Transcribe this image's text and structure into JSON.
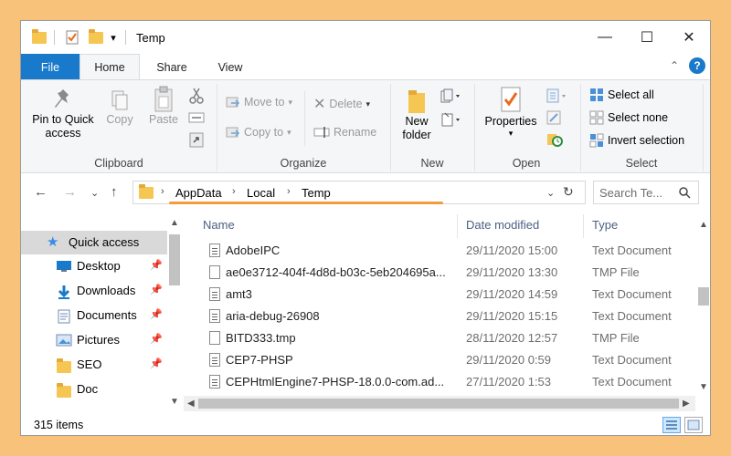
{
  "window": {
    "title": "Temp"
  },
  "controls": {
    "minimize": "—",
    "maximize": "☐",
    "close": "✕",
    "dropdown": "▾",
    "collapse": "⌃",
    "help": "?"
  },
  "tabs": [
    {
      "label": "File"
    },
    {
      "label": "Home"
    },
    {
      "label": "Share"
    },
    {
      "label": "View"
    }
  ],
  "ribbon": {
    "clipboard": {
      "group": "Clipboard",
      "pin_line1": "Pin to Quick",
      "pin_line2": "access",
      "copy": "Copy",
      "paste": "Paste"
    },
    "organize": {
      "group": "Organize",
      "move_to": "Move to",
      "copy_to": "Copy to",
      "delete": "Delete",
      "rename": "Rename"
    },
    "new": {
      "group": "New",
      "new_line1": "New",
      "new_line2": "folder"
    },
    "open": {
      "group": "Open",
      "properties": "Properties"
    },
    "select": {
      "group": "Select",
      "select_all": "Select all",
      "select_none": "Select none",
      "invert": "Invert selection"
    }
  },
  "address": {
    "breadcrumbs": [
      "AppData",
      "Local",
      "Temp"
    ],
    "search_placeholder": "Search Te..."
  },
  "nav_pane": {
    "items": [
      {
        "label": "Quick access",
        "icon": "star-icon",
        "pinned": false
      },
      {
        "label": "Desktop",
        "icon": "desktop-icon",
        "pinned": true
      },
      {
        "label": "Downloads",
        "icon": "download-arrow-icon",
        "pinned": true
      },
      {
        "label": "Documents",
        "icon": "documents-icon",
        "pinned": true
      },
      {
        "label": "Pictures",
        "icon": "pictures-icon",
        "pinned": true
      },
      {
        "label": "SEO",
        "icon": "folder-icon",
        "pinned": true
      },
      {
        "label": "Doc",
        "icon": "folder-icon",
        "pinned": false
      }
    ]
  },
  "file_list": {
    "columns": {
      "name": "Name",
      "date": "Date modified",
      "type": "Type"
    },
    "rows": [
      {
        "name": "AdobeIPC",
        "date": "29/11/2020 15:00",
        "type": "Text Document"
      },
      {
        "name": "ae0e3712-404f-4d8d-b03c-5eb204695a...",
        "date": "29/11/2020 13:30",
        "type": "TMP File"
      },
      {
        "name": "amt3",
        "date": "29/11/2020 14:59",
        "type": "Text Document"
      },
      {
        "name": "aria-debug-26908",
        "date": "29/11/2020 15:15",
        "type": "Text Document"
      },
      {
        "name": "BITD333.tmp",
        "date": "28/11/2020 12:57",
        "type": "TMP File"
      },
      {
        "name": "CEP7-PHSP",
        "date": "29/11/2020 0:59",
        "type": "Text Document"
      },
      {
        "name": "CEPHtmlEngine7-PHSP-18.0.0-com.ad...",
        "date": "27/11/2020 1:53",
        "type": "Text Document"
      }
    ]
  },
  "status": {
    "items": "315 items"
  },
  "colors": {
    "accent": "#1979CA",
    "background": "#F8C27A",
    "highlight": "#F39C3A",
    "folder": "#F6C653"
  }
}
